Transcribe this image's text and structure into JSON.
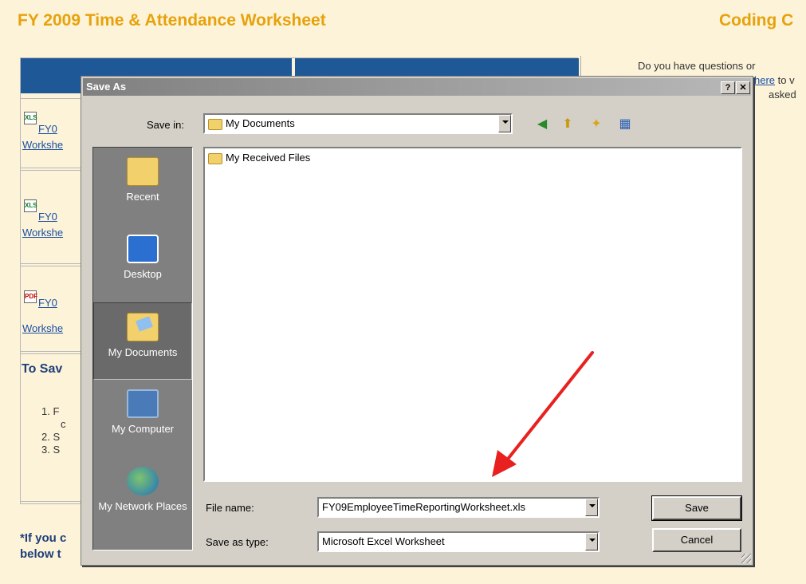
{
  "page": {
    "title": "FY 2009 Time & Attendance Worksheet",
    "title_right": "Coding C",
    "right_text_1": "Do you have questions or",
    "right_link": "here",
    "right_text_2": "to v",
    "right_text_3": "asked",
    "rows": [
      {
        "link_top": "FY0",
        "link_bottom": "Workshe",
        "icon": "XLS"
      },
      {
        "link_top": "FY0",
        "link_bottom": "Workshe",
        "icon": "XLS"
      },
      {
        "link_top": "FY0",
        "link_bottom": "Workshe",
        "icon": "PDF"
      }
    ],
    "to_save_heading": "To Sav",
    "steps": [
      "1.  F",
      "c",
      "2.  S",
      "3.  S"
    ],
    "footer_line1": "*If you c",
    "footer_line2": "below t"
  },
  "dialog": {
    "title": "Save As",
    "help_btn": "?",
    "close_btn": "✕",
    "save_in_label": "Save in:",
    "save_in_value": "My Documents",
    "places": [
      {
        "label": "Recent",
        "icon": "folder-icon"
      },
      {
        "label": "Desktop",
        "icon": "desktop-icon"
      },
      {
        "label": "My Documents",
        "icon": "my-documents-icon"
      },
      {
        "label": "My Computer",
        "icon": "my-computer-icon"
      },
      {
        "label": "My Network Places",
        "icon": "network-icon"
      }
    ],
    "files": [
      "My Received Files"
    ],
    "file_name_label": "File name:",
    "file_name_value": "FY09EmployeeTimeReportingWorksheet.xls",
    "save_type_label": "Save as type:",
    "save_type_value": "Microsoft Excel Worksheet",
    "save_button": "Save",
    "cancel_button": "Cancel",
    "toolbar_icons": [
      "back-icon",
      "up-folder-icon",
      "new-folder-icon",
      "views-icon"
    ]
  },
  "colors": {
    "page_bg": "#fcf3d9",
    "title_orange": "#e7a20b",
    "header_blue": "#1f5896",
    "dialog_gray": "#d4d0c8",
    "annotation_red": "#e8201f"
  }
}
